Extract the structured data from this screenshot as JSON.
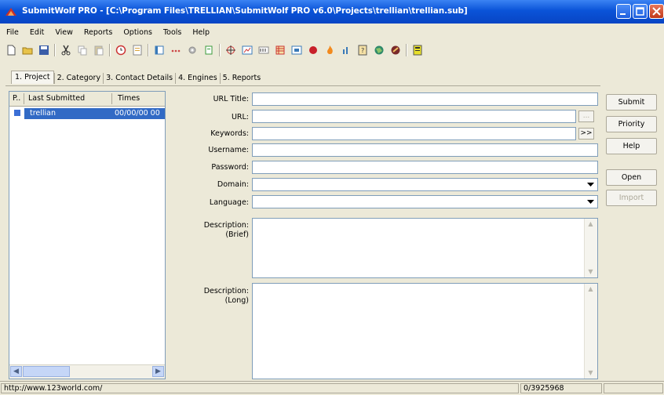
{
  "window": {
    "title": "SubmitWolf PRO - [C:\\Program Files\\TRELLIAN\\SubmitWolf PRO v6.0\\Projects\\trellian\\trellian.sub]"
  },
  "menu": [
    "File",
    "Edit",
    "View",
    "Reports",
    "Options",
    "Tools",
    "Help"
  ],
  "toolbar_icons": [
    "new-icon",
    "open-folder-icon",
    "save-icon",
    "cut-icon",
    "copy-icon",
    "paste-icon",
    "clock-icon",
    "document-icon",
    "panel-icon",
    "ellipsis-icon",
    "gear-icon",
    "copy-doc-icon",
    "crosshair-icon",
    "chart-icon",
    "abc-icon",
    "grid-icon",
    "window-icon",
    "record-icon",
    "fire-icon",
    "bars-icon",
    "help-doc-icon",
    "globe-icon",
    "rocket-icon",
    "calculator-icon"
  ],
  "tabs": [
    "1. Project",
    "2. Category",
    "3. Contact Details",
    "4. Engines",
    "5. Reports"
  ],
  "list": {
    "columns": [
      "P..",
      "Last Submitted",
      "Times"
    ],
    "rows": [
      {
        "name": "trellian",
        "time": "00/00/00 00"
      }
    ]
  },
  "form": {
    "url_title_label": "URL Title:",
    "url_label": "URL:",
    "keywords_label": "Keywords:",
    "username_label": "Username:",
    "password_label": "Password:",
    "domain_label": "Domain:",
    "language_label": "Language:",
    "desc_brief_label": "Description:",
    "desc_brief_label2": "(Brief)",
    "desc_long_label": "Description:",
    "desc_long_label2": "(Long)",
    "url_more": "...",
    "keywords_more": ">>"
  },
  "buttons": {
    "submit": "Submit",
    "priority": "Priority",
    "help": "Help",
    "open": "Open",
    "import": "Import"
  },
  "status": {
    "url": "http://www.123world.com/",
    "counter": "0/3925968"
  }
}
